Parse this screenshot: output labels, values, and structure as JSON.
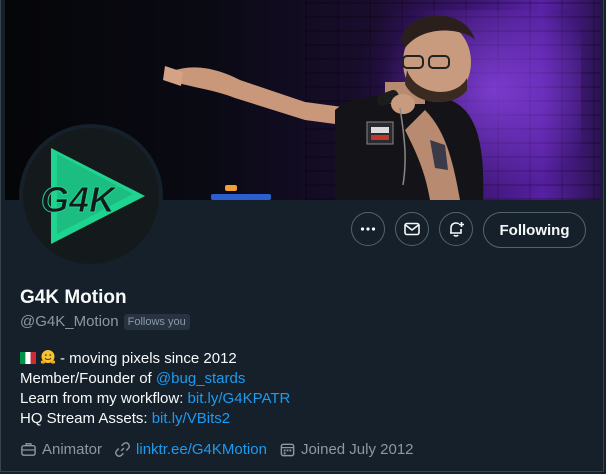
{
  "profile": {
    "name": "G4K Motion",
    "handle": "@G4K_Motion",
    "follows_you": "Follows you",
    "avatar_text": "G4K"
  },
  "actions": {
    "more_label": "More",
    "message_label": "Message",
    "notify_label": "Turn on notifications",
    "following_label": "Following"
  },
  "bio": {
    "line1_text": "-  moving pixels since 2012",
    "line2_prefix": "Member/Founder of ",
    "line2_link": "@bug_stards",
    "line3_prefix": "Learn from my workflow: ",
    "line3_link": "bit.ly/G4KPATR",
    "line4_prefix": "HQ Stream Assets: ",
    "line4_link": "bit.ly/VBits2"
  },
  "meta": {
    "profession": "Animator",
    "website": "linktr.ee/G4KMotion",
    "joined": "Joined July 2012"
  },
  "colors": {
    "background": "#15202b",
    "link": "#1d9bf0",
    "muted": "#8b98a5",
    "avatar_green": "#1ed490"
  },
  "icons": {
    "more": "more-dots-icon",
    "message": "envelope-icon",
    "notify": "bell-plus-icon",
    "profession": "briefcase-icon",
    "website": "link-icon",
    "joined": "calendar-icon"
  }
}
